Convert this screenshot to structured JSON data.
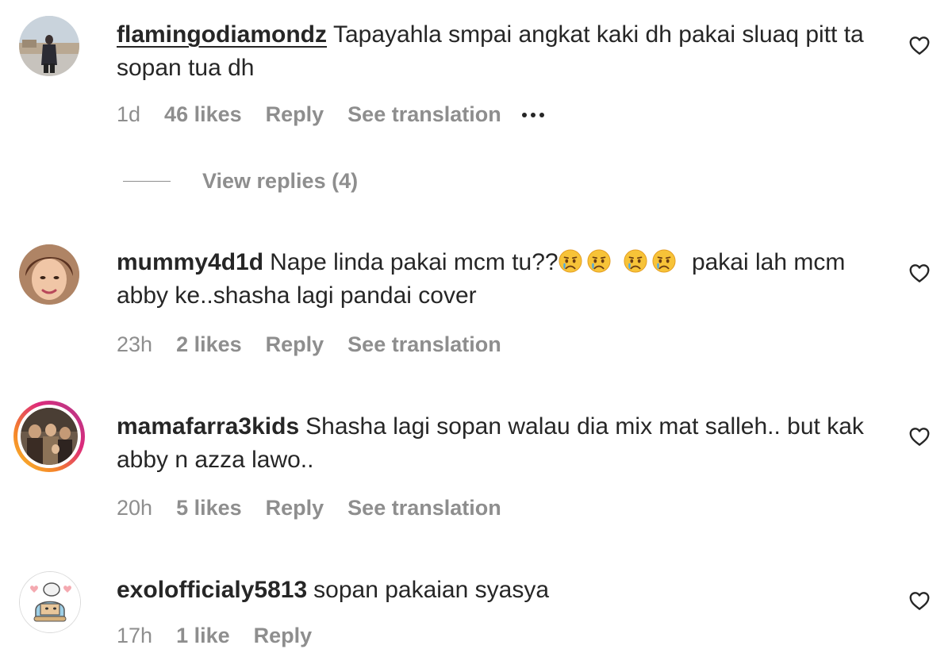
{
  "comments": [
    {
      "username": "flamingodiamondz",
      "text": "Tapayahla smpai angkat kaki dh pakai sluaq pitt ta sopan tua dh",
      "time": "1d",
      "likes": "46 likes",
      "reply_label": "Reply",
      "translate_label": "See translation",
      "view_replies": "View replies (4)"
    },
    {
      "username": "mummy4d1d",
      "text_before": "Nape linda pakai mcm tu??",
      "emojis": [
        "crying-sad-face",
        "crying-sad-face",
        "crying-sad-face",
        "crying-sad-face"
      ],
      "text_after": "pakai lah mcm abby ke..shasha lagi pandai cover",
      "time": "23h",
      "likes": "2 likes",
      "reply_label": "Reply",
      "translate_label": "See translation"
    },
    {
      "username": "mamafarra3kids",
      "text": "Shasha lagi sopan walau dia mix mat salleh.. but kak abby n azza lawo..",
      "time": "20h",
      "likes": "5 likes",
      "reply_label": "Reply",
      "translate_label": "See translation"
    },
    {
      "username": "exolofficialy5813",
      "text": "sopan pakaian syasya",
      "time": "17h",
      "likes": "1 like",
      "reply_label": "Reply"
    }
  ],
  "icons": {
    "like": "heart-outline-icon",
    "more": "more-options-icon"
  },
  "colors": {
    "text_primary": "#262626",
    "text_secondary": "#8e8e8e",
    "story_ring_start": "#f9c22e",
    "story_ring_end": "#c13584"
  }
}
